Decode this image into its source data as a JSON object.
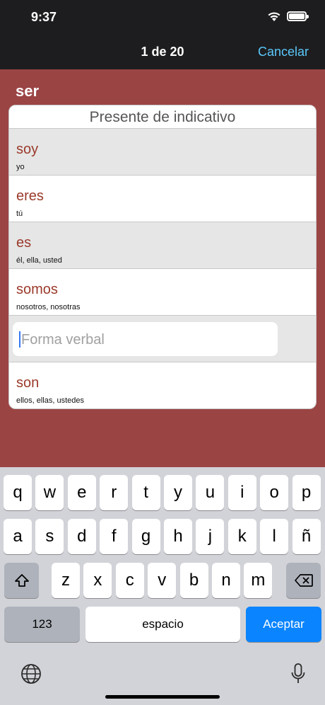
{
  "status_bar": {
    "time": "9:37"
  },
  "nav": {
    "title": "1 de 20",
    "cancel_label": "Cancelar"
  },
  "verb": "ser",
  "card": {
    "header": "Presente de indicativo",
    "rows": [
      {
        "form": "soy",
        "pronoun": "yo"
      },
      {
        "form": "eres",
        "pronoun": "tú"
      },
      {
        "form": "es",
        "pronoun": "él, ella, usted"
      },
      {
        "form": "somos",
        "pronoun": "nosotros, nosotras"
      },
      {
        "input_placeholder": "Forma verbal"
      },
      {
        "form": "son",
        "pronoun": "ellos, ellas, ustedes"
      }
    ]
  },
  "keyboard": {
    "row1": [
      "q",
      "w",
      "e",
      "r",
      "t",
      "y",
      "u",
      "i",
      "o",
      "p"
    ],
    "row2": [
      "a",
      "s",
      "d",
      "f",
      "g",
      "h",
      "j",
      "k",
      "l",
      "ñ"
    ],
    "row3": [
      "z",
      "x",
      "c",
      "v",
      "b",
      "n",
      "m"
    ],
    "numbers_label": "123",
    "space_label": "espacio",
    "accept_label": "Aceptar"
  },
  "colors": {
    "background": "#9b4444",
    "verb_form": "#9b3a2b",
    "accent": "#0a84ff",
    "cancel": "#5ac8fa"
  },
  "icons": [
    "wifi-icon",
    "battery-icon",
    "shift-icon",
    "backspace-icon",
    "globe-icon",
    "microphone-icon"
  ]
}
